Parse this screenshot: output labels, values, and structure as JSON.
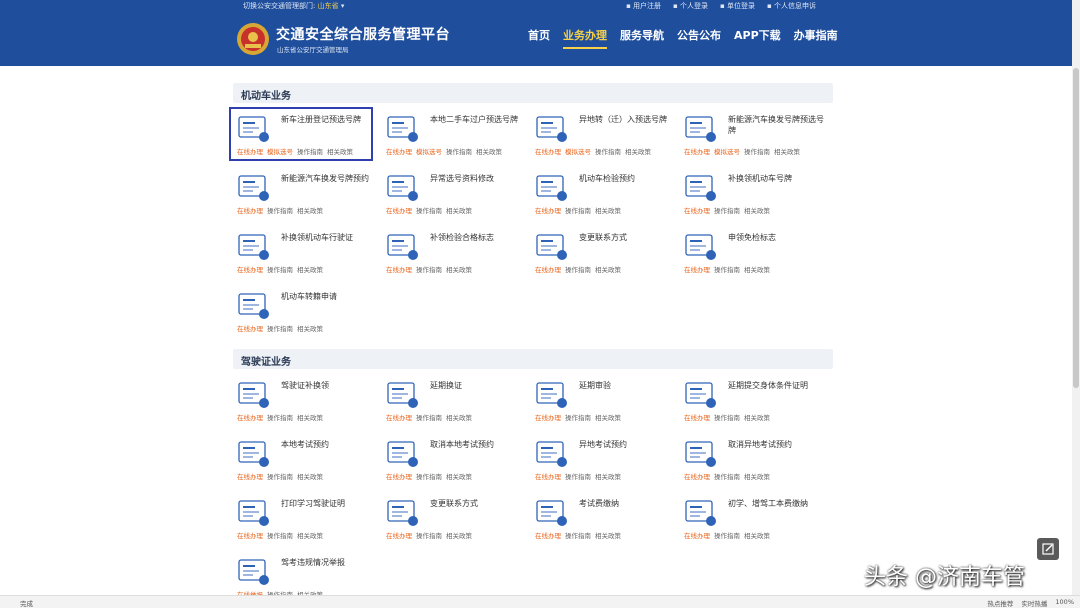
{
  "topbar": {
    "switch_label": "切换公安交通管理部门:",
    "province": "山东省",
    "links": [
      "用户注册",
      "个人登录",
      "单位登录",
      "个人信息申诉"
    ]
  },
  "header": {
    "title": "交通安全综合服务管理平台",
    "subtitle": "山东省公安厅交通管理局"
  },
  "nav": [
    {
      "label": "首页",
      "active": false
    },
    {
      "label": "业务办理",
      "active": true
    },
    {
      "label": "服务导航",
      "active": false
    },
    {
      "label": "公告公布",
      "active": false
    },
    {
      "label": "APP下载",
      "active": false
    },
    {
      "label": "办事指南",
      "active": false
    }
  ],
  "sections": {
    "vehicle": "机动车业务",
    "license": "驾驶证业务"
  },
  "vehicle_services": [
    {
      "name": "新车注册登记预选号牌",
      "links": [
        "在线办理",
        "模拟选号",
        "操作指南",
        "相关政策"
      ],
      "icon": "car-card-icon"
    },
    {
      "name": "本地二手车过户预选号牌",
      "links": [
        "在线办理",
        "模拟选号",
        "操作指南",
        "相关政策"
      ],
      "icon": "car-transfer-icon"
    },
    {
      "name": "异地转（迁）入预选号牌",
      "links": [
        "在线办理",
        "模拟选号",
        "操作指南",
        "相关政策"
      ],
      "icon": "car-move-icon"
    },
    {
      "name": "新能源汽车换发号牌预选号牌",
      "links": [
        "在线办理",
        "模拟选号",
        "操作指南",
        "相关政策"
      ],
      "icon": "ev-car-icon"
    },
    {
      "name": "新能源汽车换发号牌预约",
      "links": [
        "在线办理",
        "操作指南",
        "相关政策"
      ],
      "icon": "ev-plate-icon"
    },
    {
      "name": "异常选号资料修改",
      "links": [
        "在线办理",
        "操作指南",
        "相关政策"
      ],
      "icon": "plate-edit-icon"
    },
    {
      "name": "机动车检验预约",
      "links": [
        "在线办理",
        "操作指南",
        "相关政策"
      ],
      "icon": "inspection-icon"
    },
    {
      "name": "补换领机动车号牌",
      "links": [
        "在线办理",
        "操作指南",
        "相关政策"
      ],
      "icon": "plate-replace-icon"
    },
    {
      "name": "补换领机动车行驶证",
      "links": [
        "在线办理",
        "操作指南",
        "相关政策"
      ],
      "icon": "license-doc-icon"
    },
    {
      "name": "补领检验合格标志",
      "links": [
        "在线办理",
        "操作指南",
        "相关政策"
      ],
      "icon": "check-mark-icon"
    },
    {
      "name": "变更联系方式",
      "links": [
        "在线办理",
        "操作指南",
        "相关政策"
      ],
      "icon": "contact-change-icon"
    },
    {
      "name": "申领免检标志",
      "links": [
        "在线办理",
        "操作指南",
        "相关政策"
      ],
      "icon": "exempt-mark-icon"
    },
    {
      "name": "机动车转籍申请",
      "links": [
        "在线办理",
        "操作指南",
        "相关政策"
      ],
      "icon": "car-transfer-doc-icon"
    }
  ],
  "license_services": [
    {
      "name": "驾驶证补换领",
      "links": [
        "在线办理",
        "操作指南",
        "相关政策"
      ],
      "icon": "driver-card-icon"
    },
    {
      "name": "延期换证",
      "links": [
        "在线办理",
        "操作指南",
        "相关政策"
      ],
      "icon": "renew-icon"
    },
    {
      "name": "延期审验",
      "links": [
        "在线办理",
        "操作指南",
        "相关政策"
      ],
      "icon": "review-icon"
    },
    {
      "name": "延期提交身体条件证明",
      "links": [
        "在线办理",
        "操作指南",
        "相关政策"
      ],
      "icon": "health-doc-icon"
    },
    {
      "name": "本地考试预约",
      "links": [
        "在线办理",
        "操作指南",
        "相关政策"
      ],
      "icon": "exam-book-icon"
    },
    {
      "name": "取消本地考试预约",
      "links": [
        "在线办理",
        "操作指南",
        "相关政策"
      ],
      "icon": "exam-cancel-icon"
    },
    {
      "name": "异地考试预约",
      "links": [
        "在线办理",
        "操作指南",
        "相关政策"
      ],
      "icon": "remote-exam-icon"
    },
    {
      "name": "取消异地考试预约",
      "links": [
        "在线办理",
        "操作指南",
        "相关政策"
      ],
      "icon": "remote-cancel-icon"
    },
    {
      "name": "打印学习驾驶证明",
      "links": [
        "在线办理",
        "操作指南",
        "相关政策"
      ],
      "icon": "print-doc-icon"
    },
    {
      "name": "变更联系方式",
      "links": [
        "在线办理",
        "操作指南",
        "相关政策"
      ],
      "icon": "contact-change-icon"
    },
    {
      "name": "考试费缴纳",
      "links": [
        "在线办理",
        "操作指南",
        "相关政策"
      ],
      "icon": "fee-icon"
    },
    {
      "name": "初学、增驾工本费缴纳",
      "links": [
        "在线办理",
        "操作指南",
        "相关政策"
      ],
      "icon": "fee-card-icon"
    },
    {
      "name": "驾考违规情况举报",
      "links": [
        "在线举报",
        "操作指南",
        "相关政策"
      ],
      "icon": "report-icon"
    }
  ],
  "status": {
    "left": "完成",
    "right": [
      "热点推荐",
      "实时热播",
      "100%"
    ]
  },
  "watermark": "头条 @济南车管",
  "colors": {
    "header": "#1e4e9c",
    "accent": "#f7d14a",
    "online": "#e9641c",
    "icon_blue": "#2f63b8"
  }
}
